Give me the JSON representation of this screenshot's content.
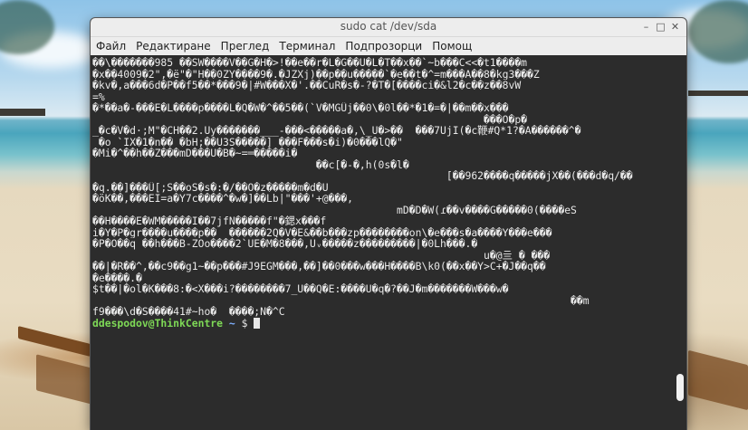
{
  "window": {
    "title": "sudo cat /dev/sda",
    "minimize_glyph": "–",
    "maximize_glyph": "□",
    "close_glyph": "✕"
  },
  "menu": {
    "items": [
      "Файл",
      "Редактиране",
      "Преглед",
      "Терминал",
      "Подпрозорци",
      "Помощ"
    ]
  },
  "terminal": {
    "lines": [
      "��\\�������985 ��SW����V��G�H�>!��e��r�L�G��U�L�T��x��`~b���C<<�t1����m",
      "�x��4009�2\",�ë\"�\"H��0ZY����9�.�JZXj)��p��u�����`�e��t�^=m���A��8�kg3���Z",
      "�kv�,a���6d�P��f5��*���9�|#W���X�'.��CuR�s�-?�T�[����ci�&l2�c��z��8vW",
      "=%",
      "�*��a�-���E�L����p����L�Q�W�^��5��(`V�MGÛj��0\\�0l��*�1�=�|��m��x���",
      "                                                               ���O�p�",
      "_�c�V�d·;M\"�CH��2.Uy�������___-���<�����a�,\\_U�>��  ���7UjI(�c鞭#Q*1?�A������^�",
      " �o `IX�1�n�� �bH;��U3S�����] ���F���s�i)�0���lQ�\"",
      "�Mi�^��h��Z���mD���U�B�~=═�����i�",
      "                                    ��c[�-�,h(0s�l�",
      "                                                         [��962����q�����jX��(���d�q/��",
      "�q.��]���Û[;S��oS�s�:�/��O�z�����m�d�U",
      "�öK��,���EI=a�Y7c����^�w�]��Lb|\"���'+@���,",
      "                                                 mD�D�W(ɾ��v����G�����0(����eS",
      "��H����E�WM�����I��7jfN�����f\"�鍶x���f",
      "i�Y�P�gr����u����p��  ������2Q�V�E&��b���zp��������on\\�e���s�a����Y���e���",
      "�P�O��q ��h���B-ZOo����2`UE�M�8���,Uᵥ�����z���������|�0Lh���.�",
      "                                                               u�@亖 � ���",
      "��|�R��^,��c9��g1~��p���#J9EGM���,��]��0���w���H����B\\k0(��x��Y>C+�J��q��",
      "�e����.�",
      "$t��|�ol�K���8:�<X���i?��������7_U��Q�E:����U�q�?��J�m�������W���w�",
      "                                                                             ��m",
      "f9���\\d�S����41#~ho�  ����;N�^C"
    ],
    "prompt_user": "ddespodov@ThinkCentre",
    "prompt_path": "~",
    "prompt_symbol": "$"
  }
}
